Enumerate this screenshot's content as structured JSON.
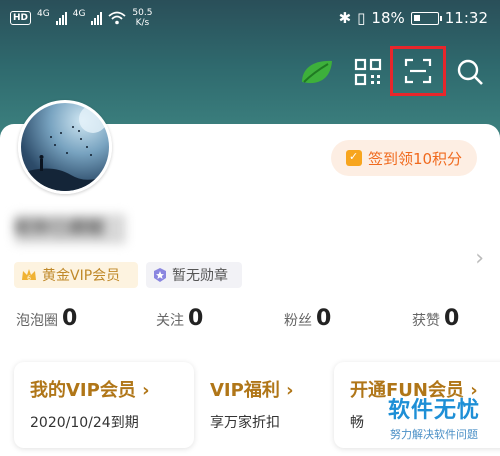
{
  "status_bar": {
    "hd": "HD",
    "sim1": "4G",
    "sim2": "4G",
    "speed_value": "50.5",
    "speed_unit": "K/s",
    "battery": "18%",
    "time": "11:32"
  },
  "header_icons": [
    "leaf-icon",
    "qr-code-icon",
    "scan-icon",
    "search-icon"
  ],
  "signin": {
    "label": "签到领10积分"
  },
  "profile": {
    "username": "昵称已模糊"
  },
  "badges": {
    "vip": "黄金VIP会员",
    "medal": "暂无勋章"
  },
  "stats": [
    {
      "label": "泡泡圈",
      "value": "0"
    },
    {
      "label": "关注",
      "value": "0"
    },
    {
      "label": "粉丝",
      "value": "0"
    },
    {
      "label": "获赞",
      "value": "0"
    }
  ],
  "benefits": [
    {
      "title": "我的VIP会员 ›",
      "sub": "2020/10/24到期"
    },
    {
      "title": "VIP福利 ›",
      "sub": "享万家折扣"
    },
    {
      "title": "开通FUN会员 ›",
      "sub": "畅"
    }
  ],
  "watermark": {
    "main": "软件无忧",
    "sub": "努力解决软件问题"
  },
  "colors": {
    "accent": "#f06a1e",
    "vip_gold": "#b07618",
    "highlight_red": "#e8262b",
    "leaf_green": "#3db03b"
  }
}
